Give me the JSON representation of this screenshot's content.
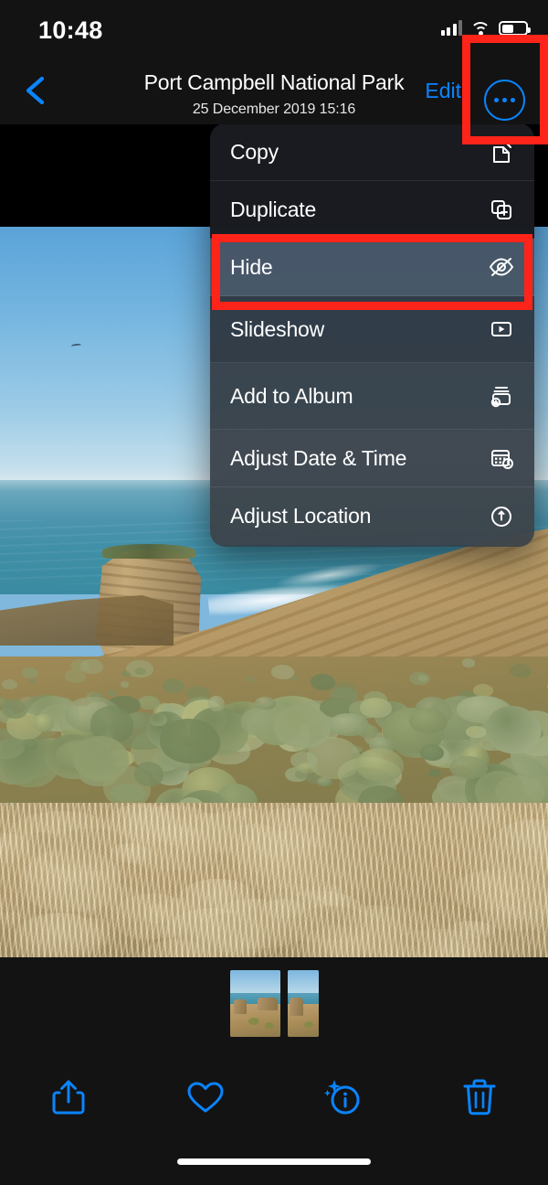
{
  "status_bar": {
    "time": "10:48",
    "icons": [
      "cellular-signal-icon",
      "wifi-icon",
      "battery-icon"
    ]
  },
  "nav_bar": {
    "back_icon": "chevron-left-icon",
    "title": "Port Campbell National Park",
    "subtitle": "25 December 2019  15:16",
    "edit_label": "Edit",
    "more_icon": "ellipsis-circle-icon"
  },
  "context_menu": {
    "items": [
      {
        "label": "Copy",
        "icon": "copy-icon",
        "highlighted": false
      },
      {
        "label": "Duplicate",
        "icon": "duplicate-icon",
        "highlighted": false
      },
      {
        "label": "Hide",
        "icon": "eye-slash-icon",
        "highlighted": true
      },
      {
        "label": "Slideshow",
        "icon": "slideshow-play-icon",
        "highlighted": false
      },
      {
        "label": "Add to Album",
        "icon": "add-to-album-icon",
        "highlighted": false
      },
      {
        "label": "Adjust Date & Time",
        "icon": "calendar-clock-icon",
        "highlighted": false
      },
      {
        "label": "Adjust Location",
        "icon": "location-pin-icon",
        "highlighted": false
      }
    ]
  },
  "toolbar": {
    "buttons": [
      {
        "name": "share-button",
        "icon": "share-icon"
      },
      {
        "name": "favorite-button",
        "icon": "heart-icon"
      },
      {
        "name": "info-button",
        "icon": "info-sparkle-icon"
      },
      {
        "name": "delete-button",
        "icon": "trash-icon"
      }
    ],
    "accent_color": "#0a84ff"
  },
  "filmstrip": {
    "thumbnails": [
      {
        "name": "thumbnail-selected",
        "selected": true
      },
      {
        "name": "thumbnail-next",
        "selected": false
      }
    ]
  },
  "annotations": {
    "highlight_color": "#ff2419",
    "boxes": [
      {
        "name": "annotation-more-button",
        "target": "more-button"
      },
      {
        "name": "annotation-hide-item",
        "target": "menu-item-hide"
      }
    ]
  },
  "colors": {
    "background": "#000000",
    "chrome": "#131313",
    "accent": "#0a84ff",
    "menu_bg": "rgba(45,52,60,0.82)",
    "highlight_row": "rgba(72,88,106,0.95)"
  }
}
